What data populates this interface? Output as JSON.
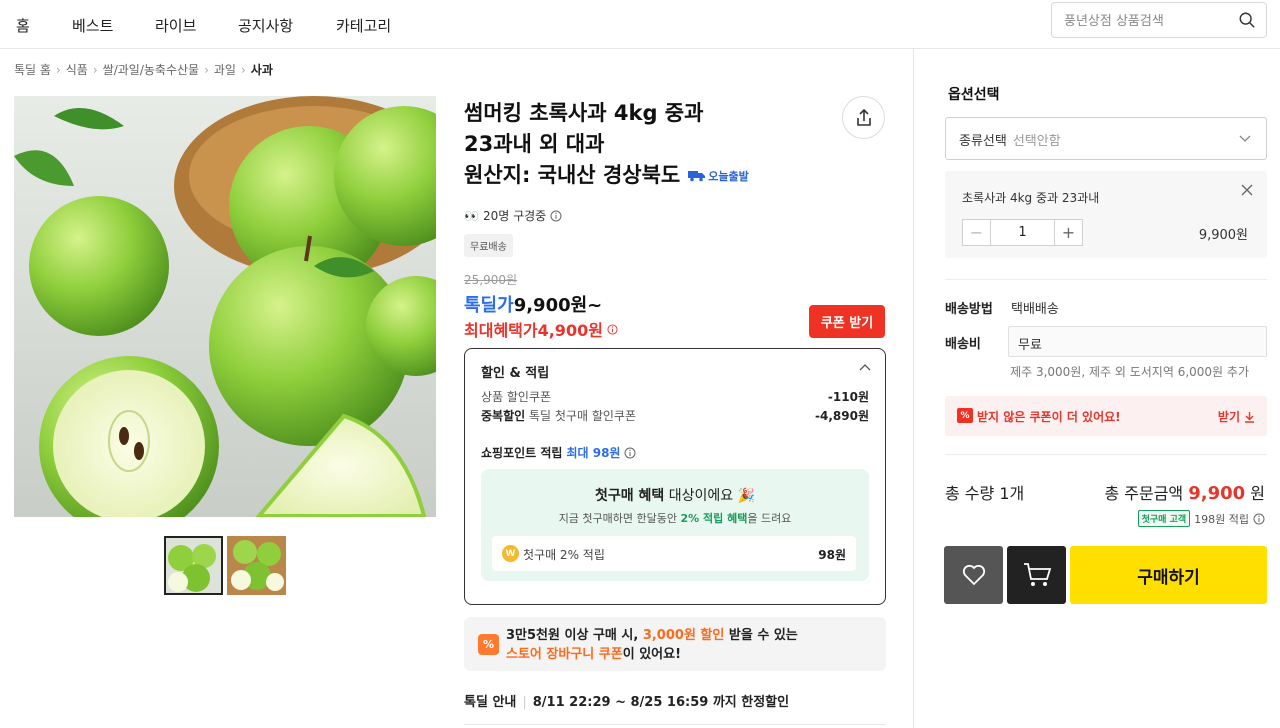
{
  "nav": {
    "items": [
      {
        "label": "홈"
      },
      {
        "label": "베스트"
      },
      {
        "label": "라이브"
      },
      {
        "label": "공지사항"
      },
      {
        "label": "카테고리"
      }
    ],
    "search_placeholder": "풍년상점 상품검색"
  },
  "breadcrumb": [
    "톡딜 홈",
    "식품",
    "쌀/과일/농축수산물",
    "과일",
    "사과"
  ],
  "product": {
    "title_line1": "썸머킹 초록사과 4kg 중과",
    "title_line2": "23과내 외 대과",
    "title_line3": "원산지: 국내산 경상북도",
    "ship_badge": "오늘출발",
    "viewers": "20명 구경중",
    "free_shipping": "무료배송",
    "original_price": "25,900원",
    "tokdeal_label": "톡딜가",
    "tokdeal_price": "9,900원~",
    "max_benefit": "최대혜택가4,900원",
    "coupon_button": "쿠폰 받기"
  },
  "discount": {
    "title": "할인 & 적립",
    "rows": [
      {
        "label": "상품 할인쿠폰",
        "value": "-110원"
      },
      {
        "label_bold": "중복할인",
        "label": "톡딜 첫구매 할인쿠폰",
        "value": "-4,890원"
      }
    ],
    "point_label": "쇼핑포인트 적립",
    "point_value": "최대 98원",
    "first_purchase": {
      "title_bold": "첫구매 혜택",
      "title_rest": " 대상이에요",
      "sub_before": "지금 첫구매하면 한달동안 ",
      "sub_green": "2% 적립 혜택",
      "sub_after": "을 드려요",
      "item_name": "첫구매 2% 적립",
      "item_points": "98원"
    }
  },
  "cart_banner": {
    "line1_a": "3만5천원 이상 구매 시, ",
    "line1_orange": "3,000원 할인",
    "line1_b": " 받을 수 있는",
    "line2_orange": "스토어 장바구니 쿠폰",
    "line2_b": "이 있어요!"
  },
  "tokdeal_info": {
    "label": "톡딜 안내",
    "period": "8/11 22:29 ~ 8/25 16:59 까지 한정할인"
  },
  "panel": {
    "option_title": "옵션선택",
    "select_label": "종류선택",
    "select_placeholder": "선택안함",
    "selected_option": "초록사과 4kg 중과 23과내",
    "quantity": "1",
    "option_price": "9,900원",
    "ship_method_label": "배송방법",
    "ship_method": "택배배송",
    "ship_fee_label": "배송비",
    "ship_fee": "무료",
    "ship_fee_note": "제주 3,000원, 제주 외 도서지역 6,000원 추가",
    "coupon_notice": "받지 않은 쿠폰이 더 있어요!",
    "coupon_get": "받기",
    "total_qty": "총 수량 1개",
    "total_label": "총 주문금액",
    "total_amount": "9,900",
    "total_unit": "원",
    "earn_badge": "첫구매 고객",
    "earn_text": "198원 적립",
    "buy_button": "구매하기"
  },
  "colors": {
    "accent_red": "#e8352c",
    "accent_blue": "#2c6ee8",
    "buy_yellow": "#ffdf00",
    "green": "#1a9c5c"
  }
}
